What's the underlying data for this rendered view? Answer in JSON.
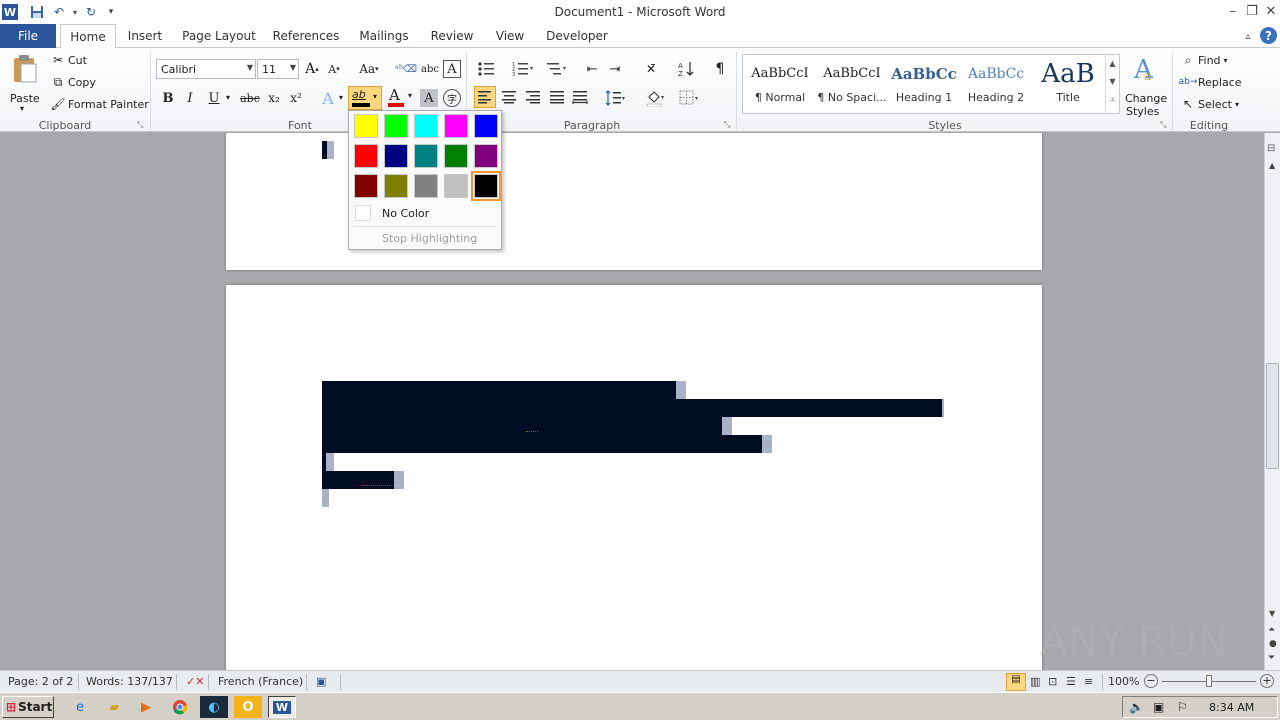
{
  "window": {
    "title": "Document1 - Microsoft Word",
    "app_icon": "word-icon",
    "qat": [
      "save-icon",
      "undo-icon",
      "redo-icon",
      "customize-qat-icon"
    ],
    "controls": [
      "minimize-icon",
      "restore-icon",
      "close-icon"
    ]
  },
  "tabs": [
    "File",
    "Home",
    "Insert",
    "Page Layout",
    "References",
    "Mailings",
    "Review",
    "View",
    "Developer"
  ],
  "active_tab": "Home",
  "ribbon": {
    "clipboard": {
      "paste_label": "Paste",
      "cut_label": "Cut",
      "copy_label": "Copy",
      "format_painter_label": "Format Painter",
      "group_label": "Clipboard"
    },
    "font": {
      "font_name": "Calibri",
      "font_size": "11",
      "group_label": "Font",
      "grow": "A",
      "shrink": "A",
      "change_case": "Aa",
      "bold": "B",
      "italic": "I",
      "underline": "U",
      "strikethrough": "abc",
      "subscript": "x₂",
      "superscript": "x²",
      "text_effects": "A",
      "highlight": "ab",
      "font_color": "A"
    },
    "paragraph": {
      "group_label": "Paragraph",
      "show_marks": "¶"
    },
    "styles": {
      "group_label": "Styles",
      "items": [
        {
          "sample": "AaBbCcI",
          "name": "¶ Normal"
        },
        {
          "sample": "AaBbCcI",
          "name": "¶ No Spaci..."
        },
        {
          "sample": "AaBbCс",
          "name": "Heading 1"
        },
        {
          "sample": "AaBbCc",
          "name": "Heading 2"
        },
        {
          "sample": "AaB",
          "name": "Title"
        }
      ],
      "change_styles_line1": "Change",
      "change_styles_line2": "Styles"
    },
    "editing": {
      "find_label": "Find",
      "replace_label": "Replace",
      "select_label": "Select",
      "group_label": "Editing"
    }
  },
  "highlight_dropdown": {
    "colors": [
      [
        "#ffff00",
        "#00ff00",
        "#00ffff",
        "#ff00ff",
        "#0000ff"
      ],
      [
        "#ff0000",
        "#000080",
        "#008080",
        "#008000",
        "#800080"
      ],
      [
        "#800000",
        "#808000",
        "#808080",
        "#c0c0c0",
        "#000000"
      ]
    ],
    "selected_color": "#000000",
    "no_color_label": "No Color",
    "stop_highlighting_label": "Stop Highlighting"
  },
  "status_bar": {
    "page": "Page: 2 of 2",
    "words": "Words: 137/137",
    "language": "French (France)",
    "zoom": "100%"
  },
  "taskbar": {
    "start_label": "Start",
    "time": "8:34 AM"
  },
  "watermark": "ANY RUN"
}
